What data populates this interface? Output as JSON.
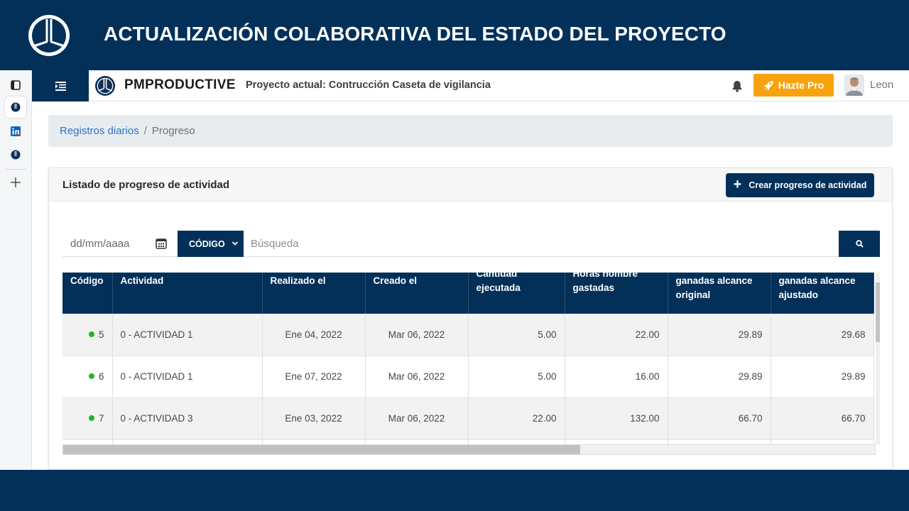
{
  "slide": {
    "title": "ACTUALIZACIÓN COLABORATIVA DEL ESTADO DEL PROYECTO",
    "logo_icon": "pmproductive-logo-icon",
    "background": "#023059"
  },
  "browser_sidebar": {
    "items": [
      {
        "icon": "sidebar-panel-icon"
      },
      {
        "icon": "pmproductive-app-icon",
        "active": true
      },
      {
        "icon": "linkedin-icon"
      },
      {
        "icon": "pmproductive-app-icon"
      },
      {
        "icon": "plus-icon"
      }
    ]
  },
  "header": {
    "menu_icon": "menu-toggle-icon",
    "brand": "PMPRODUCTIVE",
    "project_label": "Proyecto actual: Contrucción Caseta de vigilancia",
    "bell_icon": "bell-icon",
    "pro_button": "Hazte Pro",
    "pro_icon": "rocket-icon",
    "pro_color": "#f6a30f",
    "user_name": "Leon"
  },
  "breadcrumb": {
    "link": "Registros diarios",
    "separator": "/",
    "current": "Progreso"
  },
  "card": {
    "title": "Listado de progreso de actividad",
    "create_button": "Crear progreso de actividad"
  },
  "filters": {
    "date_placeholder": "dd/mm/aaaa",
    "select_value": "CÓDIGO",
    "search_placeholder": "Búsqueda"
  },
  "table": {
    "columns": [
      {
        "line1": "Código",
        "line2": ""
      },
      {
        "line1": "Actividad",
        "line2": ""
      },
      {
        "line1": "Realizado el",
        "line2": ""
      },
      {
        "line1": "Creado el",
        "line2": ""
      },
      {
        "line1": "Cantidad",
        "line2": "ejecutada"
      },
      {
        "line1": "Horas hombre",
        "line2": "gastadas"
      },
      {
        "line1": "ganadas alcance",
        "line2": "original"
      },
      {
        "line1": "ganadas alcance",
        "line2": "ajustado"
      }
    ],
    "rows": [
      {
        "code": "5",
        "activity": "0 - ACTIVIDAD 1",
        "done": "Ene 04, 2022",
        "created": "Mar 06, 2022",
        "qty": "5.00",
        "hours": "22.00",
        "orig": "29.89",
        "adj": "29.68"
      },
      {
        "code": "6",
        "activity": "0 - ACTIVIDAD 1",
        "done": "Ene 07, 2022",
        "created": "Mar 06, 2022",
        "qty": "5.00",
        "hours": "16.00",
        "orig": "29.89",
        "adj": "29.89"
      },
      {
        "code": "7",
        "activity": "0 - ACTIVIDAD 3",
        "done": "Ene 03, 2022",
        "created": "Mar 06, 2022",
        "qty": "22.00",
        "hours": "132.00",
        "orig": "66.70",
        "adj": "66.70"
      },
      {
        "code": "",
        "activity": "",
        "done": "",
        "created": "",
        "qty": "",
        "hours": "",
        "orig": "",
        "adj": ""
      }
    ],
    "status_color": "#21b52a",
    "horizontal_scroll_position": 0
  }
}
